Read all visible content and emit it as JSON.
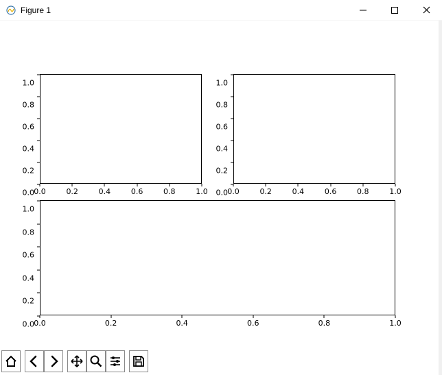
{
  "window": {
    "title": "Figure 1"
  },
  "chart_data": [
    {
      "type": "line",
      "position": "top-left",
      "xlabel": "",
      "ylabel": "",
      "title": "",
      "xlim": [
        0.0,
        1.0
      ],
      "ylim": [
        0.0,
        1.0
      ],
      "xticks": [
        0.0,
        0.2,
        0.4,
        0.6,
        0.8,
        1.0
      ],
      "yticks": [
        0.0,
        0.2,
        0.4,
        0.6,
        0.8,
        1.0
      ],
      "series": []
    },
    {
      "type": "line",
      "position": "top-right",
      "xlabel": "",
      "ylabel": "",
      "title": "",
      "xlim": [
        0.0,
        1.0
      ],
      "ylim": [
        0.0,
        1.0
      ],
      "xticks": [
        0.0,
        0.2,
        0.4,
        0.6,
        0.8,
        1.0
      ],
      "yticks": [
        0.0,
        0.2,
        0.4,
        0.6,
        0.8,
        1.0
      ],
      "series": []
    },
    {
      "type": "line",
      "position": "bottom-full",
      "xlabel": "",
      "ylabel": "",
      "title": "",
      "xlim": [
        0.0,
        1.0
      ],
      "ylim": [
        0.0,
        1.0
      ],
      "xticks": [
        0.0,
        0.2,
        0.4,
        0.6,
        0.8,
        1.0
      ],
      "yticks": [
        0.0,
        0.2,
        0.4,
        0.6,
        0.8,
        1.0
      ],
      "series": []
    }
  ],
  "toolbar": {
    "home": "Home",
    "back": "Back",
    "forward": "Forward",
    "pan": "Pan",
    "zoom": "Zoom",
    "configure": "Configure subplots",
    "save": "Save"
  }
}
